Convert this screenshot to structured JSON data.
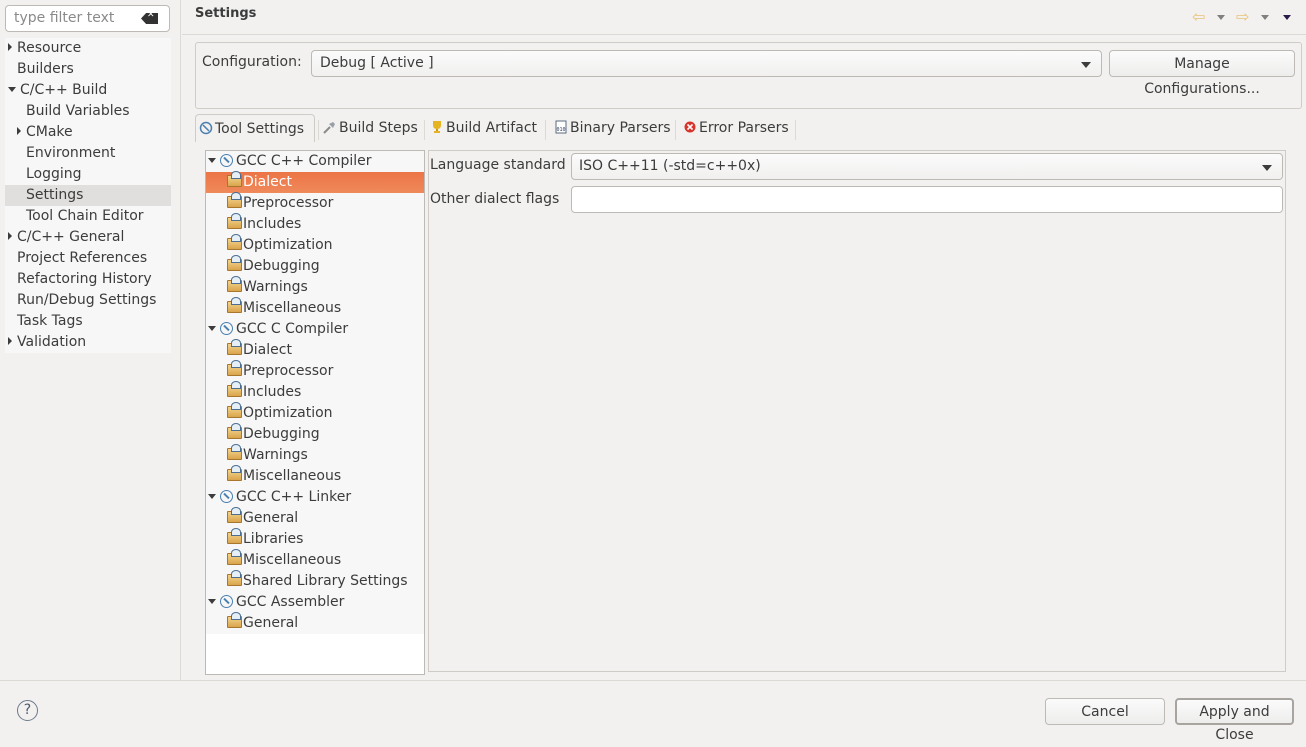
{
  "filter": {
    "placeholder": "type filter text"
  },
  "sidebar": {
    "items": [
      {
        "label": "Resource",
        "expander": "collapsed",
        "indent": 0
      },
      {
        "label": "Builders",
        "expander": "none",
        "indent": 0
      },
      {
        "label": "C/C++ Build",
        "expander": "expanded",
        "indent": 0
      },
      {
        "label": "Build Variables",
        "expander": "none",
        "indent": 1
      },
      {
        "label": "CMake",
        "expander": "collapsed",
        "indent": 1
      },
      {
        "label": "Environment",
        "expander": "none",
        "indent": 1
      },
      {
        "label": "Logging",
        "expander": "none",
        "indent": 1
      },
      {
        "label": "Settings",
        "expander": "none",
        "indent": 1,
        "selected": true
      },
      {
        "label": "Tool Chain Editor",
        "expander": "none",
        "indent": 1
      },
      {
        "label": "C/C++ General",
        "expander": "collapsed",
        "indent": 0
      },
      {
        "label": "Project References",
        "expander": "none",
        "indent": 0
      },
      {
        "label": "Refactoring History",
        "expander": "none",
        "indent": 0
      },
      {
        "label": "Run/Debug Settings",
        "expander": "none",
        "indent": 0
      },
      {
        "label": "Task Tags",
        "expander": "none",
        "indent": 0
      },
      {
        "label": "Validation",
        "expander": "collapsed",
        "indent": 0
      }
    ]
  },
  "header": {
    "title": "Settings",
    "back_icon": "back-arrow-icon",
    "forward_icon": "forward-arrow-icon",
    "menu_icon": "view-menu-icon"
  },
  "config": {
    "label": "Configuration:",
    "selected": "Debug  [ Active ]",
    "manage_label": "Manage Configurations..."
  },
  "tabs": [
    {
      "label": "Tool Settings",
      "icon": "tool-settings-icon",
      "active": true
    },
    {
      "label": "Build Steps",
      "icon": "build-steps-icon"
    },
    {
      "label": "Build Artifact",
      "icon": "build-artifact-icon"
    },
    {
      "label": "Binary Parsers",
      "icon": "binary-parsers-icon"
    },
    {
      "label": "Error Parsers",
      "icon": "error-parsers-icon"
    }
  ],
  "tool_tree": [
    {
      "label": "GCC C++ Compiler",
      "type": "tool"
    },
    {
      "label": "Dialect",
      "type": "option",
      "selected": true
    },
    {
      "label": "Preprocessor",
      "type": "option"
    },
    {
      "label": "Includes",
      "type": "option"
    },
    {
      "label": "Optimization",
      "type": "option"
    },
    {
      "label": "Debugging",
      "type": "option"
    },
    {
      "label": "Warnings",
      "type": "option"
    },
    {
      "label": "Miscellaneous",
      "type": "option"
    },
    {
      "label": "GCC C Compiler",
      "type": "tool"
    },
    {
      "label": "Dialect",
      "type": "option"
    },
    {
      "label": "Preprocessor",
      "type": "option"
    },
    {
      "label": "Includes",
      "type": "option"
    },
    {
      "label": "Optimization",
      "type": "option"
    },
    {
      "label": "Debugging",
      "type": "option"
    },
    {
      "label": "Warnings",
      "type": "option"
    },
    {
      "label": "Miscellaneous",
      "type": "option"
    },
    {
      "label": "GCC C++ Linker",
      "type": "tool"
    },
    {
      "label": "General",
      "type": "option"
    },
    {
      "label": "Libraries",
      "type": "option"
    },
    {
      "label": "Miscellaneous",
      "type": "option"
    },
    {
      "label": "Shared Library Settings",
      "type": "option"
    },
    {
      "label": "GCC Assembler",
      "type": "tool"
    },
    {
      "label": "General",
      "type": "option"
    }
  ],
  "panel": {
    "language_standard_label": "Language standard",
    "language_standard_value": "ISO C++11 (-std=c++0x)",
    "other_flags_label": "Other dialect flags",
    "other_flags_value": ""
  },
  "footer": {
    "help": "?",
    "cancel_label": "Cancel",
    "apply_label": "Apply and Close"
  }
}
